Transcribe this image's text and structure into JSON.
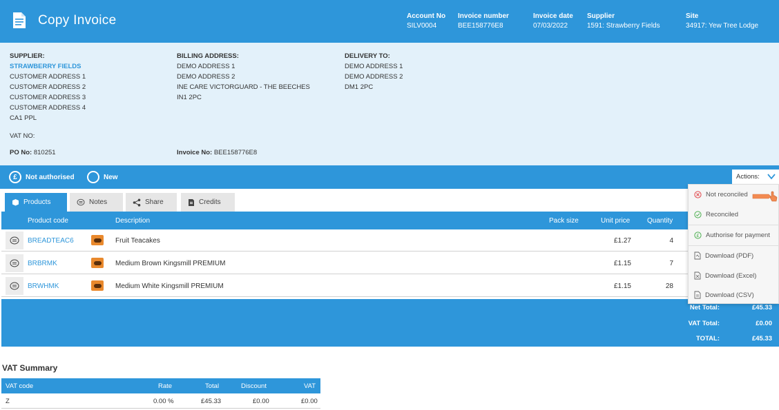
{
  "header": {
    "title": "Copy Invoice",
    "account_no_label": "Account No",
    "account_no": "SILV0004",
    "invoice_number_label": "Invoice number",
    "invoice_number": "BEE158776E8",
    "invoice_date_label": "Invoice date",
    "invoice_date": "07/03/2022",
    "supplier_label": "Supplier",
    "supplier": "1591: Strawberry Fields",
    "site_label": "Site",
    "site": "34917: Yew Tree Lodge"
  },
  "addresses": {
    "supplier_heading": "SUPPLIER:",
    "supplier_name": "STRAWBERRY FIELDS",
    "supplier_lines": [
      "CUSTOMER ADDRESS 1",
      "CUSTOMER ADDRESS 2",
      "CUSTOMER ADDRESS 3",
      "CUSTOMER ADDRESS 4",
      "CA1 PPL"
    ],
    "billing_heading": "BILLING ADDRESS:",
    "billing_lines": [
      "DEMO ADDRESS 1",
      "DEMO ADDRESS 2",
      "INE CARE VICTORGUARD - THE BEECHES",
      "IN1 2PC"
    ],
    "delivery_heading": "DELIVERY TO:",
    "delivery_lines": [
      "DEMO ADDRESS 1",
      "DEMO ADDRESS 2",
      "DM1 2PC"
    ],
    "vat_no_label": "VAT NO:",
    "po_no_label": "PO No:",
    "po_no": "810251",
    "invoice_no_label": "Invoice No:",
    "invoice_no": "BEE158776E8"
  },
  "status": {
    "authorised": "Not authorised",
    "state": "New",
    "actions_label": "Actions:"
  },
  "tabs": [
    {
      "label": "Products",
      "icon": "box-icon"
    },
    {
      "label": "Notes",
      "icon": "speech-bubble-icon"
    },
    {
      "label": "Share",
      "icon": "share-icon"
    },
    {
      "label": "Credits",
      "icon": "credits-document-icon"
    }
  ],
  "table": {
    "columns": {
      "code": "Product code",
      "description": "Description",
      "pack_size": "Pack size",
      "unit_price": "Unit price",
      "quantity": "Quantity"
    },
    "rows": [
      {
        "code": "BREADTEAC6",
        "description": "Fruit Teacakes",
        "unit_price": "£1.27",
        "quantity": "4"
      },
      {
        "code": "BRBRMK",
        "description": "Medium Brown Kingsmill PREMIUM",
        "unit_price": "£1.15",
        "quantity": "7"
      },
      {
        "code": "BRWHMK",
        "description": "Medium White Kingsmill PREMIUM",
        "unit_price": "£1.15",
        "quantity": "28"
      }
    ]
  },
  "totals": {
    "net_label": "Net Total:",
    "net": "£45.33",
    "vat_label": "VAT Total:",
    "vat": "£0.00",
    "total_label": "TOTAL:",
    "total": "£45.33"
  },
  "vat_summary": {
    "title": "VAT Summary",
    "columns": {
      "code": "VAT code",
      "rate": "Rate",
      "total": "Total",
      "discount": "Discount",
      "vat": "VAT"
    },
    "row": {
      "code": "Z",
      "rate": "0.00 %",
      "total": "£45.33",
      "discount": "£0.00",
      "vat": "£0.00"
    }
  },
  "actions_menu": [
    {
      "label": "Not reconciled",
      "icon": "x-circle-icon",
      "color": "#e0454a"
    },
    {
      "label": "Reconciled",
      "icon": "check-circle-icon",
      "color": "#4caf50"
    },
    {
      "label": "Authorise for payment",
      "icon": "pound-circle-icon",
      "color": "#4caf50"
    },
    {
      "label": "Download (PDF)",
      "icon": "pdf-file-icon",
      "color": "#666666"
    },
    {
      "label": "Download (Excel)",
      "icon": "excel-file-icon",
      "color": "#666666"
    },
    {
      "label": "Download (CSV)",
      "icon": "csv-file-icon",
      "color": "#666666"
    }
  ],
  "colors": {
    "primary": "#2e96da",
    "address_bg": "#e3f1fa",
    "accent_orange": "#f28b52"
  }
}
